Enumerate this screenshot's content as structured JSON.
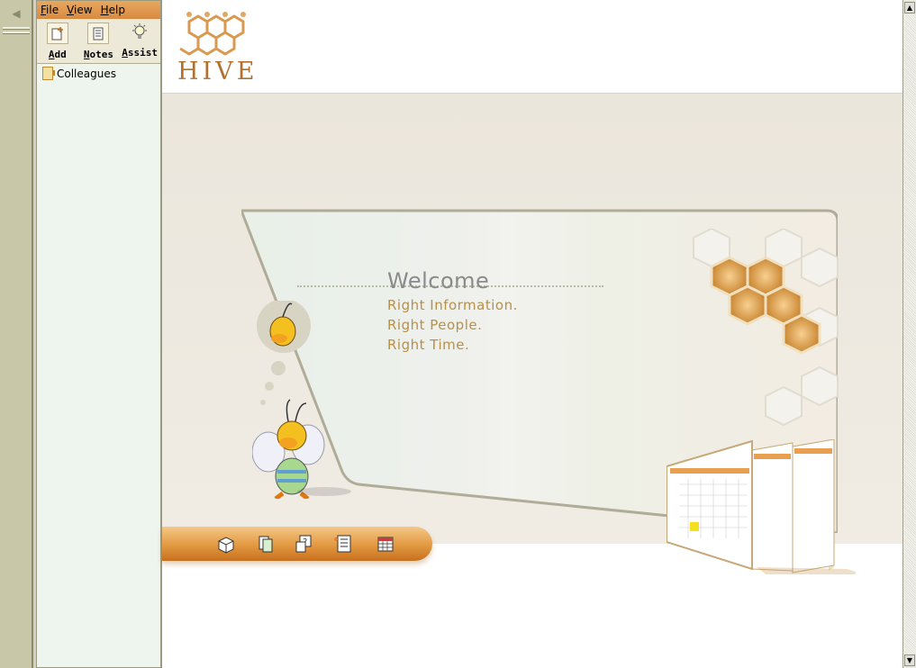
{
  "menu": {
    "file": "File",
    "view": "View",
    "help": "Help"
  },
  "toolbar": {
    "add_label": "Add",
    "notes_label": "Notes",
    "assist_label": "Assist"
  },
  "tree": {
    "root_label": "Colleagues"
  },
  "logo": {
    "text": "HIVE"
  },
  "banner": {
    "welcome": "Welcome",
    "line1": "Right Information.",
    "line2": "Right People.",
    "line3": "Right Time."
  },
  "colors": {
    "accent_orange": "#e29840",
    "logo_brown": "#b07030",
    "tagline_gold": "#b89048",
    "sidebar_bg": "#eef4ee"
  },
  "icons": [
    "back-arrow-icon",
    "add-note-icon",
    "notes-icon",
    "assist-bulb-icon",
    "folder-icon",
    "box-icon",
    "documents-icon",
    "questions-icon",
    "list-icon",
    "calendar-icon"
  ]
}
